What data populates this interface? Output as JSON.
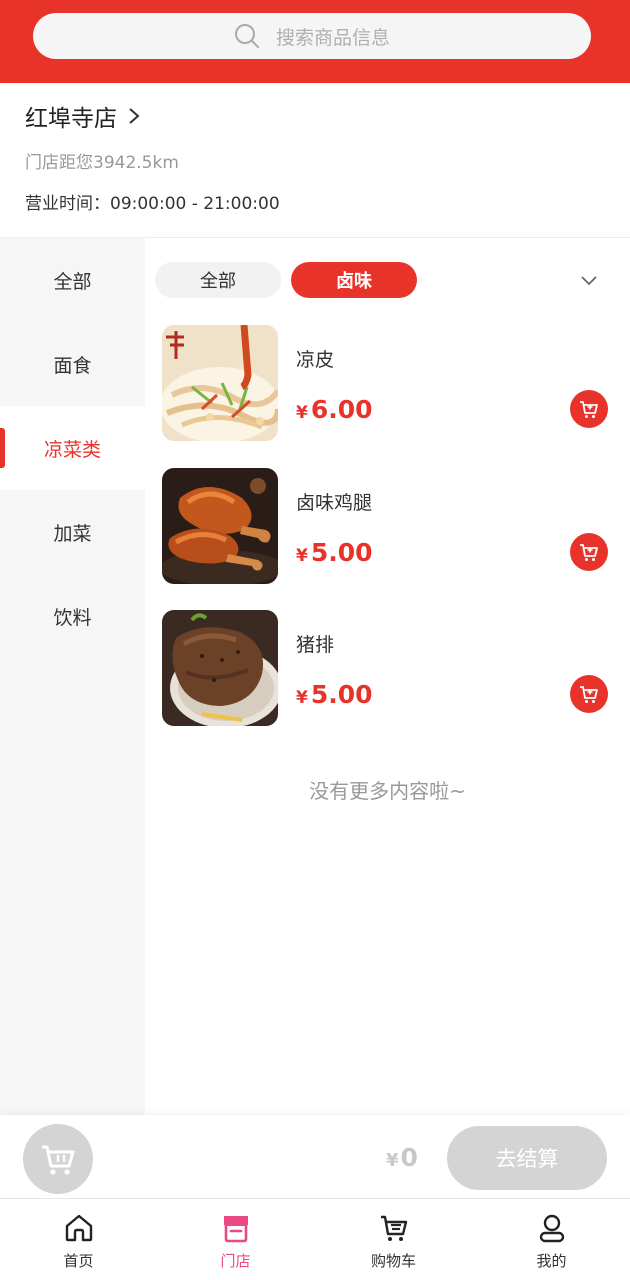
{
  "search": {
    "placeholder": "搜索商品信息",
    "icon": "search-icon"
  },
  "store": {
    "name": "红埠寺店",
    "distance": "门店距您3942.5km",
    "hours": "营业时间：09:00:00 - 21:00:00"
  },
  "sidebar": {
    "items": [
      {
        "label": "全部"
      },
      {
        "label": "面食"
      },
      {
        "label": "凉菜类"
      },
      {
        "label": "加菜"
      },
      {
        "label": "饮料"
      }
    ],
    "active_index": 2
  },
  "sub_tabs": {
    "items": [
      {
        "label": "全部"
      },
      {
        "label": "卤味"
      }
    ],
    "active_index": 1
  },
  "products": [
    {
      "name": "凉皮",
      "currency": "¥",
      "price": "6.00"
    },
    {
      "name": "卤味鸡腿",
      "currency": "¥",
      "price": "5.00"
    },
    {
      "name": "猪排",
      "currency": "¥",
      "price": "5.00"
    }
  ],
  "list_end_text": "没有更多内容啦~",
  "checkout": {
    "currency": "¥",
    "total": "0",
    "button_label": "去结算"
  },
  "tabbar": {
    "items": [
      {
        "label": "首页",
        "icon": "home-icon"
      },
      {
        "label": "门店",
        "icon": "store-icon"
      },
      {
        "label": "购物车",
        "icon": "cart-icon"
      },
      {
        "label": "我的",
        "icon": "user-icon"
      }
    ],
    "active_index": 1
  },
  "colors": {
    "brand_red": "#e8332a",
    "tab_active": "#e94a86",
    "disabled_gray": "#d4d4d4"
  }
}
